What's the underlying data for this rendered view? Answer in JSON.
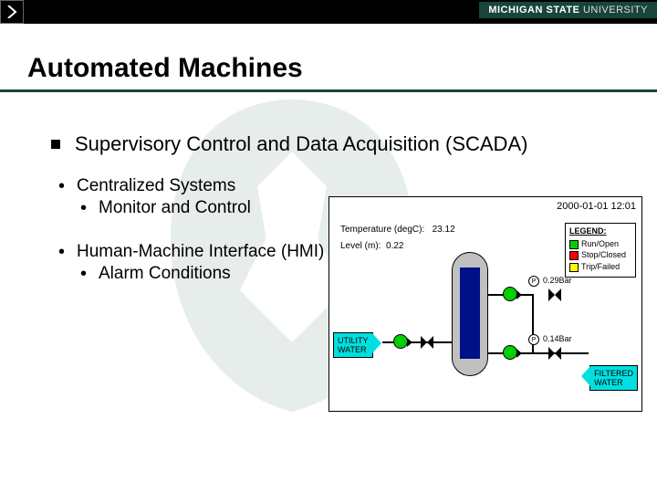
{
  "brand": {
    "name_bold": "MICHIGAN STATE",
    "name_light": "UNIVERSITY"
  },
  "slide": {
    "title": "Automated Machines",
    "main_bullet": "Supervisory Control and Data Acquisition (SCADA)",
    "sub1a": "Centralized Systems",
    "sub1a_child": "Monitor and Control",
    "sub1b": "Human-Machine Interface (HMI)",
    "sub1b_child": "Alarm Conditions"
  },
  "diagram": {
    "timestamp": "2000-01-01 12:01",
    "temp_label": "Temperature (degC):",
    "temp_value": "23.12",
    "level_label": "Level (m):",
    "level_value": "0.22",
    "legend_title": "LEGEND:",
    "legend_run": "Run/Open",
    "legend_stop": "Stop/Closed",
    "legend_trip": "Trip/Failed",
    "p1_reading": "0.29Bar",
    "p2_reading": "0.14Bar",
    "p_symbol": "P",
    "utility_label": "UTILITY\nWATER",
    "filtered_label": "FILTERED\nWATER"
  }
}
